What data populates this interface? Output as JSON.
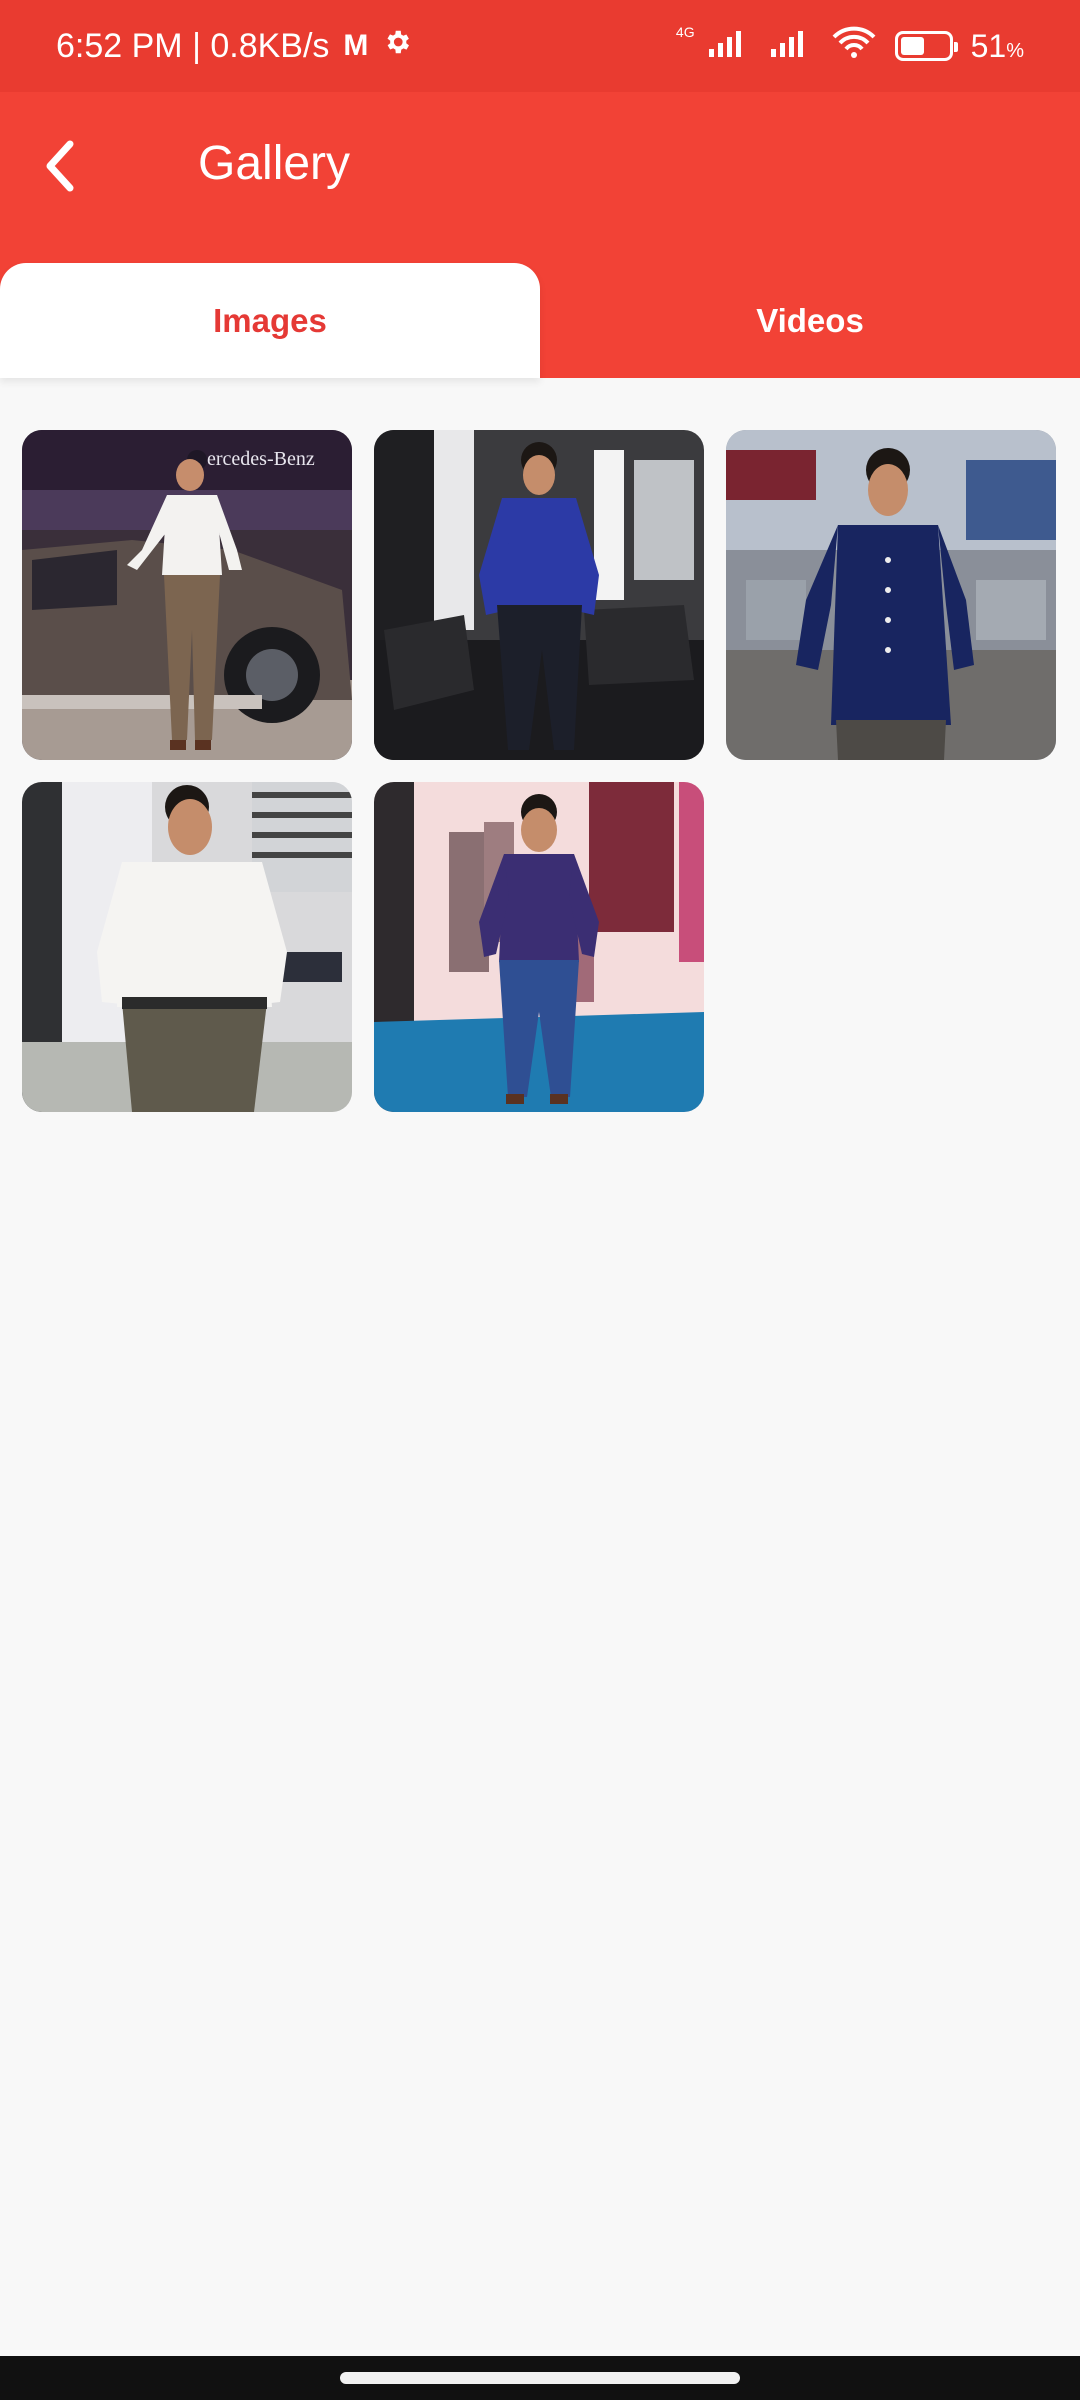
{
  "status_bar": {
    "time_speed": "6:52 PM | 0.8KB/s",
    "mail_icon": "M",
    "network_label": "4G",
    "battery_level": 0.51,
    "battery_text": "51",
    "percent_sign": "%"
  },
  "app_bar": {
    "title": "Gallery"
  },
  "tabs": [
    {
      "label": "Images",
      "active": true
    },
    {
      "label": "Videos",
      "active": false
    }
  ],
  "gallery": {
    "images": [
      {
        "id": "photo-1",
        "caption": "ercedes-Benz"
      },
      {
        "id": "photo-2"
      },
      {
        "id": "photo-3"
      },
      {
        "id": "photo-4"
      },
      {
        "id": "photo-5"
      }
    ]
  },
  "colors": {
    "status_bar": "#e93b30",
    "app_bar": "#f24236",
    "tab_active_text": "#e53935",
    "background": "#f8f8f8"
  }
}
